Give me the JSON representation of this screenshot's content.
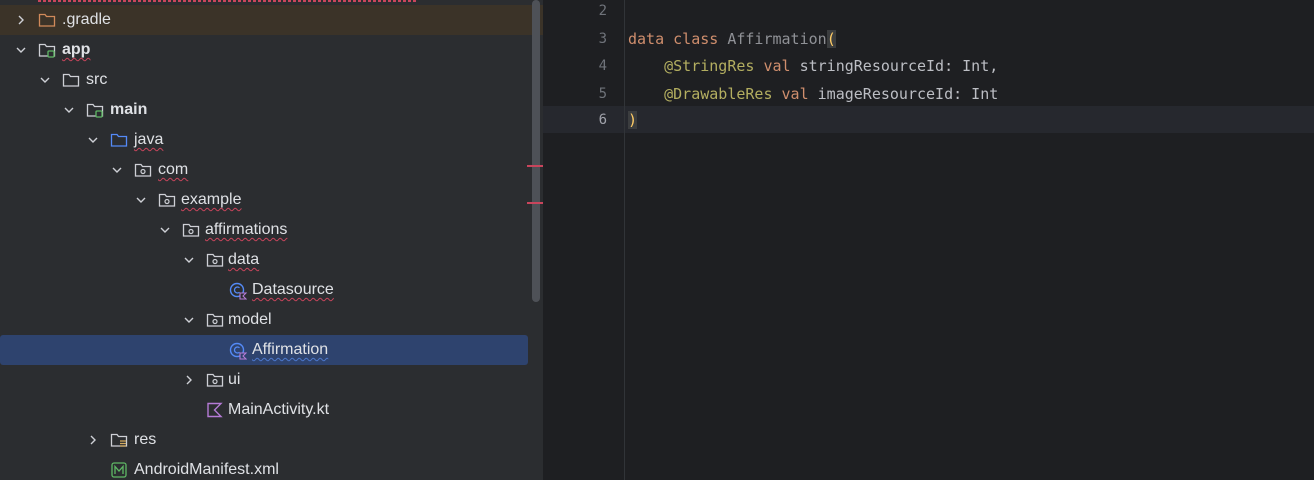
{
  "project_tree": {
    "items": [
      {
        "label": ".gradle",
        "icon": "folder-icon",
        "expanded": false
      },
      {
        "label": "app",
        "icon": "module-folder-icon",
        "expanded": true
      },
      {
        "label": "src",
        "icon": "folder-icon",
        "expanded": true
      },
      {
        "label": "main",
        "icon": "source-root-folder-icon",
        "expanded": true
      },
      {
        "label": "java",
        "icon": "java-source-folder-icon",
        "expanded": true
      },
      {
        "label": "com",
        "icon": "package-icon",
        "expanded": true
      },
      {
        "label": "example",
        "icon": "package-icon",
        "expanded": true
      },
      {
        "label": "affirmations",
        "icon": "package-icon",
        "expanded": true
      },
      {
        "label": "data",
        "icon": "package-icon",
        "expanded": true
      },
      {
        "label": "Datasource",
        "icon": "kotlin-class-icon"
      },
      {
        "label": "model",
        "icon": "package-icon",
        "expanded": true
      },
      {
        "label": "Affirmation",
        "icon": "kotlin-class-icon",
        "selected": true
      },
      {
        "label": "ui",
        "icon": "package-icon",
        "expanded": false
      },
      {
        "label": "MainActivity.kt",
        "icon": "kotlin-file-icon"
      },
      {
        "label": "res",
        "icon": "resources-folder-icon",
        "expanded": false
      },
      {
        "label": "AndroidManifest.xml",
        "icon": "manifest-icon"
      }
    ]
  },
  "editor": {
    "line_numbers": [
      "2",
      "3",
      "4",
      "5",
      "6"
    ],
    "current_line": "6",
    "lines": {
      "l3": {
        "kw1": "data",
        "kw2": "class",
        "name": "Affirmation",
        "paren": "("
      },
      "l4": {
        "anno": "@StringRes",
        "kw": "val",
        "param": "stringResourceId",
        "rest": ": Int,"
      },
      "l5": {
        "anno": "@DrawableRes",
        "kw": "val",
        "param": "imageResourceId",
        "rest": ": Int"
      },
      "l6": {
        "paren": ")"
      }
    }
  },
  "colors": {
    "tree_bg": "#2b2d30",
    "editor_bg": "#1e1f22",
    "selection": "#2e436e",
    "keyword": "#cf8e6d",
    "annotation": "#b3ae60",
    "error_underline": "#c9455c"
  }
}
